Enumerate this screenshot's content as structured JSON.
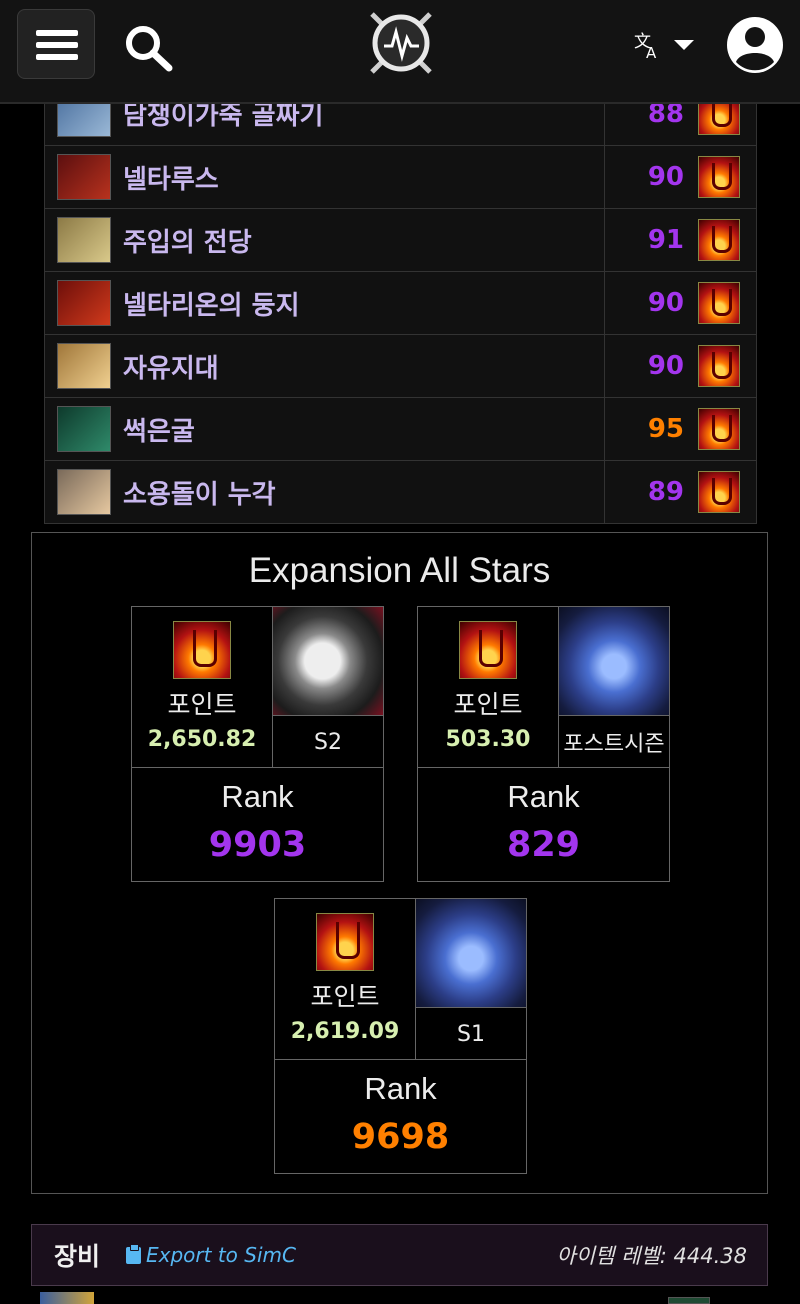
{
  "header": {
    "menu_icon": "hamburger-menu-icon",
    "search_icon": "search-icon",
    "logo_icon": "raider-io-logo-icon",
    "language_icon": "translate-icon",
    "account_icon": "account-circle-icon"
  },
  "dungeons": [
    {
      "name": "담쟁이가죽 골짜기",
      "score": "88",
      "score_color": "#a335ee",
      "thumb": [
        "#4a6f9e",
        "#9ab8d6"
      ]
    },
    {
      "name": "넬타루스",
      "score": "90",
      "score_color": "#a335ee",
      "thumb": [
        "#5c0f0f",
        "#b8321e"
      ]
    },
    {
      "name": "주입의 전당",
      "score": "91",
      "score_color": "#a335ee",
      "thumb": [
        "#8c7a46",
        "#d9c98a"
      ]
    },
    {
      "name": "넬타리온의 둥지",
      "score": "90",
      "score_color": "#a335ee",
      "thumb": [
        "#6e0f0a",
        "#d13a1c"
      ]
    },
    {
      "name": "자유지대",
      "score": "90",
      "score_color": "#a335ee",
      "thumb": [
        "#a0773a",
        "#f0d090"
      ]
    },
    {
      "name": "썩은굴",
      "score": "95",
      "score_color": "#ff8000",
      "thumb": [
        "#0e3a2c",
        "#2f8a6a"
      ]
    },
    {
      "name": "소용돌이 누각",
      "score": "89",
      "score_color": "#a335ee",
      "thumb": [
        "#7a6a5a",
        "#e6c8a0"
      ]
    }
  ],
  "expansion_all_stars": {
    "title": "Expansion All Stars",
    "cards": [
      {
        "points_label": "포인트",
        "points": "2,650.82",
        "season": "S2",
        "rank_label": "Rank",
        "rank": "9903",
        "rank_color": "#a335ee",
        "art": "dragon"
      },
      {
        "points_label": "포인트",
        "points": "503.30",
        "season": "포스트시즌",
        "rank_label": "Rank",
        "rank": "829",
        "rank_color": "#a335ee",
        "art": "storm"
      },
      {
        "points_label": "포인트",
        "points": "2,619.09",
        "season": "S1",
        "rank_label": "Rank",
        "rank": "9698",
        "rank_color": "#ff8000",
        "art": "storm"
      }
    ]
  },
  "equipment": {
    "title": "장비",
    "export_label": "Export to SimC",
    "item_level": "아이템 레벨: 444.38"
  }
}
